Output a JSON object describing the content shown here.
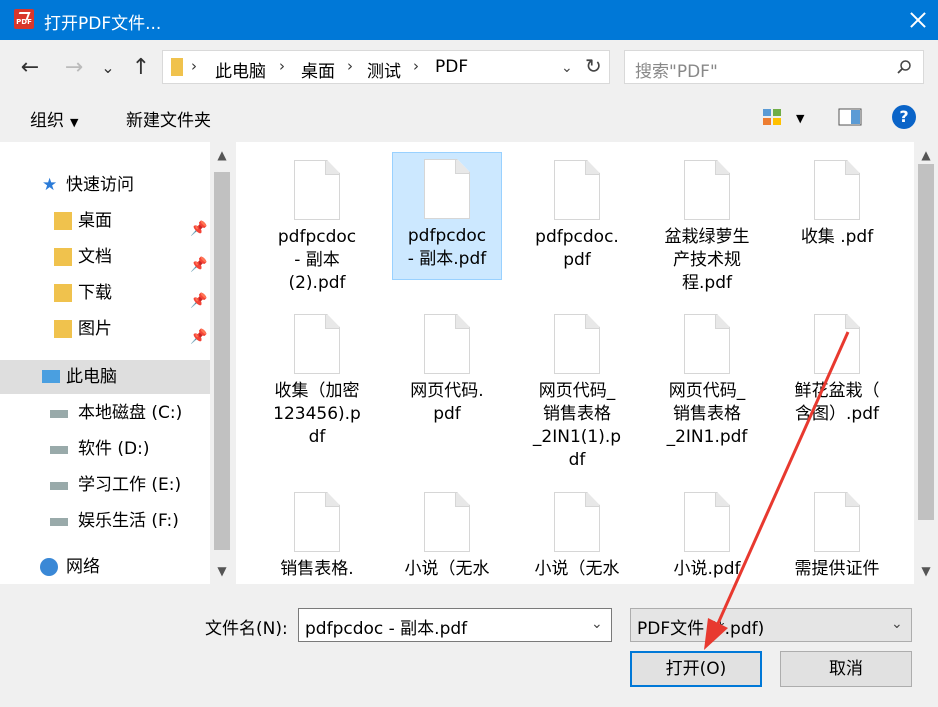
{
  "window": {
    "title": "打开PDF文件...",
    "app_icon_label": "PDF"
  },
  "nav": {
    "back": "←",
    "forward": "→",
    "recent": "⌄",
    "up": "↑",
    "breadcrumbs": [
      "此电脑",
      "桌面",
      "测试",
      "PDF"
    ],
    "refresh": "↻",
    "search_placeholder": "搜索\"PDF\""
  },
  "toolbar": {
    "organize": "组织",
    "new_folder": "新建文件夹",
    "help": "?"
  },
  "sidebar": {
    "items": [
      {
        "label": "快速访问",
        "icon": "star-icon"
      },
      {
        "label": "桌面",
        "icon": "desktop-folder-icon",
        "pinned": true
      },
      {
        "label": "文档",
        "icon": "documents-folder-icon",
        "pinned": true
      },
      {
        "label": "下载",
        "icon": "downloads-folder-icon",
        "pinned": true
      },
      {
        "label": "图片",
        "icon": "pictures-folder-icon",
        "pinned": true
      },
      {
        "label": "此电脑",
        "icon": "computer-icon",
        "selected": true
      },
      {
        "label": "本地磁盘 (C:)",
        "icon": "drive-icon"
      },
      {
        "label": "软件 (D:)",
        "icon": "drive-icon"
      },
      {
        "label": "学习工作 (E:)",
        "icon": "drive-icon"
      },
      {
        "label": "娱乐生活 (F:)",
        "icon": "drive-icon"
      },
      {
        "label": "网络",
        "icon": "network-icon"
      }
    ]
  },
  "files": [
    {
      "lines": [
        "pdfpcdoc",
        "- 副本",
        "(2).pdf"
      ]
    },
    {
      "lines": [
        "pdfpcdoc",
        "- 副本.pdf"
      ],
      "selected": true
    },
    {
      "lines": [
        "pdfpcdoc.",
        "pdf"
      ]
    },
    {
      "lines": [
        "盆栽绿萝生",
        "产技术规",
        "程.pdf"
      ]
    },
    {
      "lines": [
        "收集 .pdf"
      ]
    },
    {
      "lines": [
        "收集（加密",
        "123456).p",
        "df"
      ]
    },
    {
      "lines": [
        "网页代码.",
        "pdf"
      ]
    },
    {
      "lines": [
        "网页代码_",
        "销售表格",
        "_2IN1(1).p",
        "df"
      ]
    },
    {
      "lines": [
        "网页代码_",
        "销售表格",
        "_2IN1.pdf"
      ]
    },
    {
      "lines": [
        "鲜花盆栽（",
        "含图）.pdf"
      ]
    },
    {
      "lines": [
        "销售表格."
      ]
    },
    {
      "lines": [
        "小说（无水"
      ]
    },
    {
      "lines": [
        "小说（无水"
      ]
    },
    {
      "lines": [
        "小说.pdf"
      ]
    },
    {
      "lines": [
        "需提供证件"
      ]
    }
  ],
  "bottom": {
    "filename_label": "文件名(N):",
    "filename_value": "pdfpcdoc - 副本.pdf",
    "filetype_value": "PDF文件 (*.pdf)",
    "open_button": "打开(O)",
    "cancel_button": "取消"
  },
  "colors": {
    "titlebar": "#0078d7",
    "selection": "#cce8ff",
    "annotation": "#e8392f"
  }
}
